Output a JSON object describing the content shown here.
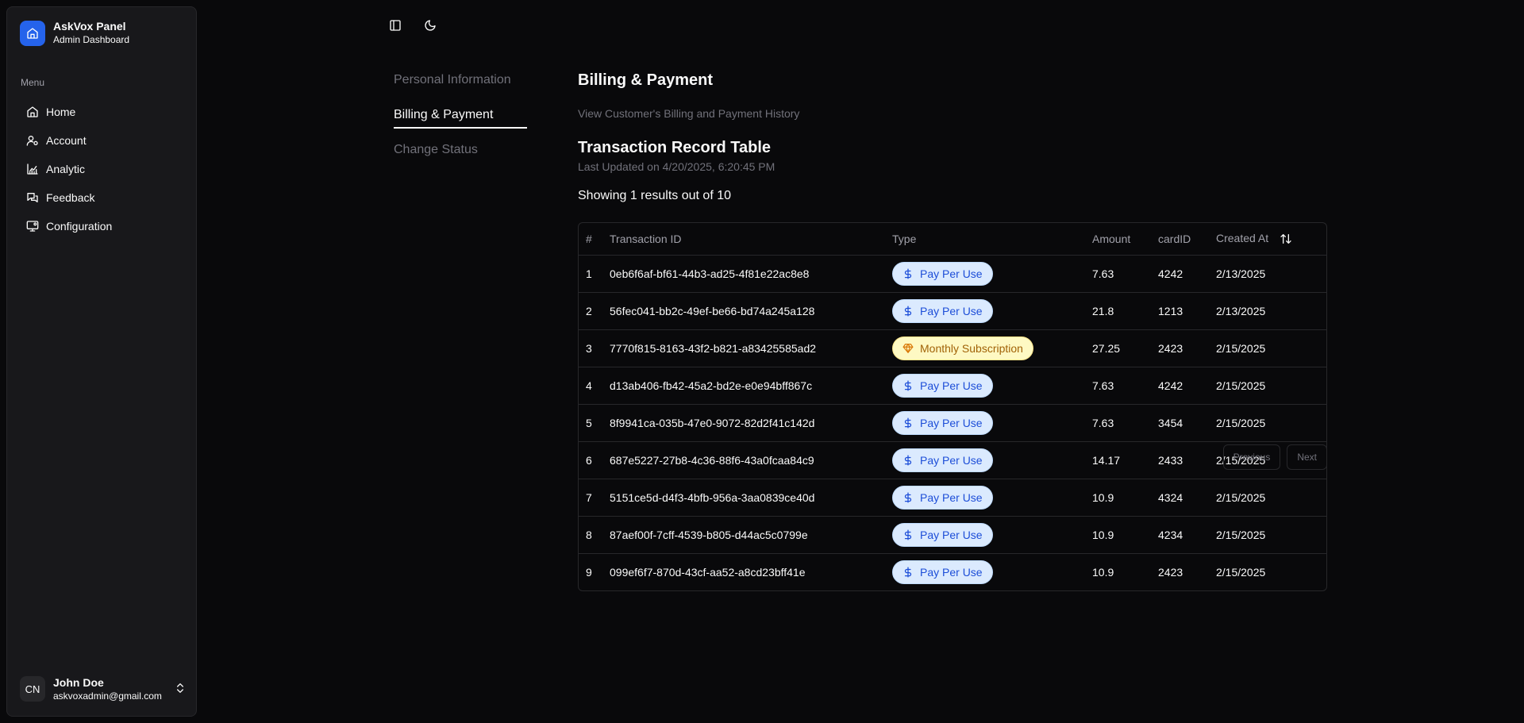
{
  "sidebar": {
    "brand_title": "AskVox Panel",
    "brand_subtitle": "Admin Dashboard",
    "menu_label": "Menu",
    "items": [
      {
        "label": "Home",
        "icon": "home-icon"
      },
      {
        "label": "Account",
        "icon": "user-cog-icon"
      },
      {
        "label": "Analytic",
        "icon": "chart-icon"
      },
      {
        "label": "Feedback",
        "icon": "messages-icon"
      },
      {
        "label": "Configuration",
        "icon": "monitor-cog-icon"
      }
    ],
    "user": {
      "initials": "CN",
      "name": "John Doe",
      "email": "askvoxadmin@gmail.com"
    }
  },
  "subnav": {
    "items": [
      "Personal Information",
      "Billing & Payment",
      "Change Status"
    ],
    "active": "Billing & Payment"
  },
  "content": {
    "title": "Billing & Payment",
    "description": "View Customer's Billing and Payment History",
    "table_title": "Transaction Record Table",
    "last_updated": "Last Updated on 4/20/2025, 6:20:45 PM",
    "showing": "Showing 1 results out of 10"
  },
  "table": {
    "headers": [
      "#",
      "Transaction ID",
      "Type",
      "Amount",
      "cardID",
      "Created At"
    ],
    "rows": [
      {
        "idx": "1",
        "id": "0eb6f6af-bf61-44b3-ad25-4f81e22ac8e8",
        "type": "Pay Per Use",
        "kind": "ppu",
        "amount": "7.63",
        "card": "4242",
        "created": "2/13/2025"
      },
      {
        "idx": "2",
        "id": "56fec041-bb2c-49ef-be66-bd74a245a128",
        "type": "Pay Per Use",
        "kind": "ppu",
        "amount": "21.8",
        "card": "1213",
        "created": "2/13/2025"
      },
      {
        "idx": "3",
        "id": "7770f815-8163-43f2-b821-a83425585ad2",
        "type": "Monthly Subscription",
        "kind": "sub",
        "amount": "27.25",
        "card": "2423",
        "created": "2/15/2025"
      },
      {
        "idx": "4",
        "id": "d13ab406-fb42-45a2-bd2e-e0e94bff867c",
        "type": "Pay Per Use",
        "kind": "ppu",
        "amount": "7.63",
        "card": "4242",
        "created": "2/15/2025"
      },
      {
        "idx": "5",
        "id": "8f9941ca-035b-47e0-9072-82d2f41c142d",
        "type": "Pay Per Use",
        "kind": "ppu",
        "amount": "7.63",
        "card": "3454",
        "created": "2/15/2025"
      },
      {
        "idx": "6",
        "id": "687e5227-27b8-4c36-88f6-43a0fcaa84c9",
        "type": "Pay Per Use",
        "kind": "ppu",
        "amount": "14.17",
        "card": "2433",
        "created": "2/15/2025"
      },
      {
        "idx": "7",
        "id": "5151ce5d-d4f3-4bfb-956a-3aa0839ce40d",
        "type": "Pay Per Use",
        "kind": "ppu",
        "amount": "10.9",
        "card": "4324",
        "created": "2/15/2025"
      },
      {
        "idx": "8",
        "id": "87aef00f-7cff-4539-b805-d44ac5c0799e",
        "type": "Pay Per Use",
        "kind": "ppu",
        "amount": "10.9",
        "card": "4234",
        "created": "2/15/2025"
      },
      {
        "idx": "9",
        "id": "099ef6f7-870d-43cf-aa52-a8cd23bff41e",
        "type": "Pay Per Use",
        "kind": "ppu",
        "amount": "10.9",
        "card": "2423",
        "created": "2/15/2025"
      }
    ]
  },
  "pagination": {
    "previous": "Previous",
    "next": "Next"
  },
  "colors": {
    "accent": "#2563eb",
    "background": "#09090b",
    "sidebar": "#18181b",
    "ppu_badge": "#dbeafe",
    "subscription_badge": "#fef9c3"
  }
}
